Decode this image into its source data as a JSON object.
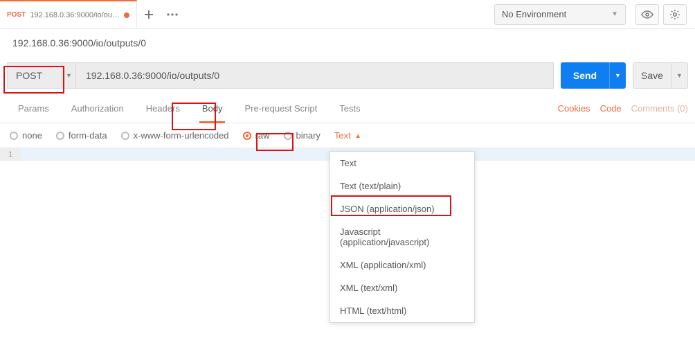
{
  "tab": {
    "method": "POST",
    "title": "192.168.0.36:9000/io/outputs/0"
  },
  "environment": {
    "label": "No Environment"
  },
  "url_display": "192.168.0.36:9000/io/outputs/0",
  "method": "POST",
  "url_input": "192.168.0.36:9000/io/outputs/0",
  "send_label": "Send",
  "save_label": "Save",
  "request_tabs": {
    "params": "Params",
    "authorization": "Authorization",
    "headers": "Headers",
    "body": "Body",
    "prerequest": "Pre-request Script",
    "tests": "Tests"
  },
  "right_links": {
    "cookies": "Cookies",
    "code": "Code",
    "comments": "Comments (0)"
  },
  "body_types": {
    "none": "none",
    "form_data": "form-data",
    "urlencoded": "x-www-form-urlencoded",
    "raw": "raw",
    "binary": "binary"
  },
  "content_type_selected": "Text",
  "content_type_options": [
    "Text",
    "Text (text/plain)",
    "JSON (application/json)",
    "Javascript (application/javascript)",
    "XML (application/xml)",
    "XML (text/xml)",
    "HTML (text/html)"
  ],
  "editor": {
    "line1": "1"
  }
}
